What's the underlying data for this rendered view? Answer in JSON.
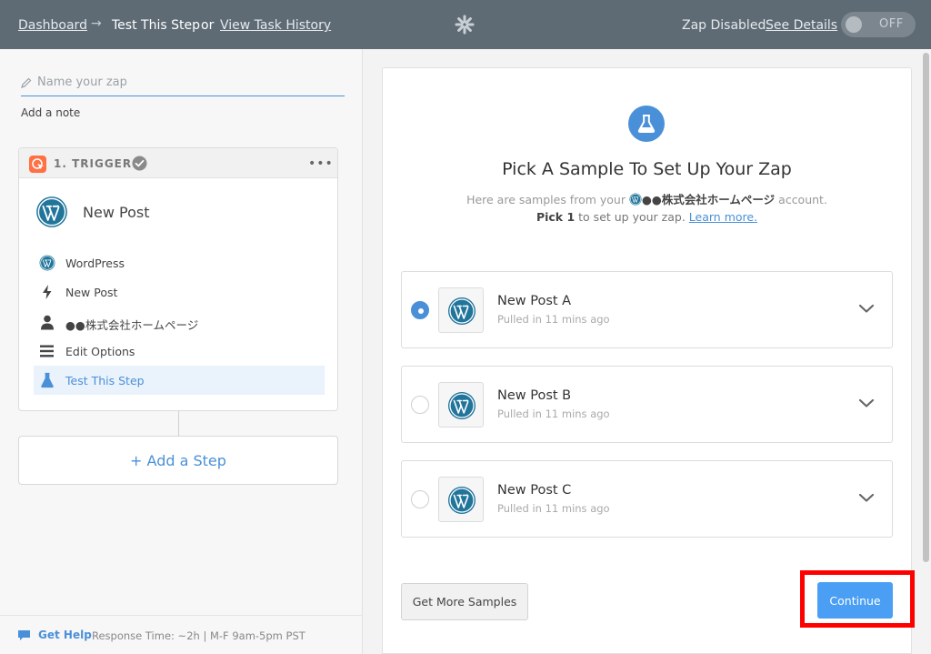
{
  "topbar": {
    "dashboard": "Dashboard",
    "arrow": "→",
    "current": "Test This Step",
    "or": "or",
    "history": "View Task History",
    "status": "Zap Disabled.",
    "details": "See Details",
    "toggle": "OFF"
  },
  "sidebar": {
    "zap_name_placeholder": "Name your zap",
    "add_note": "Add a note",
    "trigger": {
      "label": "1. TRIGGER",
      "menu": "•••",
      "app_title": "New Post",
      "rows": [
        {
          "label": "WordPress",
          "icon": "wordpress-icon"
        },
        {
          "label": "New Post",
          "icon": "bolt-icon"
        },
        {
          "label": "●●株式会社ホームページ",
          "icon": "user-icon"
        },
        {
          "label": "Edit Options",
          "icon": "lines-icon"
        },
        {
          "label": "Test This Step",
          "icon": "flask-icon"
        }
      ]
    },
    "add_step": "Add a Step",
    "add_step_plus": "+",
    "help": {
      "link": "Get Help",
      "text": "Response Time: ~2h | M-F 9am-5pm PST"
    }
  },
  "main": {
    "title": "Pick A Sample To Set Up Your Zap",
    "sub_before": "Here are samples from your",
    "account": "●●株式会社ホームページ",
    "sub_after": "account.",
    "pick": "Pick 1",
    "pick_rest": "to set up your zap.",
    "learn": "Learn more.",
    "samples": [
      {
        "title": "New Post A",
        "sub": "Pulled in 11 mins ago"
      },
      {
        "title": "New Post B",
        "sub": "Pulled in 11 mins ago"
      },
      {
        "title": "New Post C",
        "sub": "Pulled in 11 mins ago"
      }
    ],
    "more_button": "Get More Samples",
    "continue_button": "Continue"
  },
  "colors": {
    "accent": "#4a90d9",
    "topbar": "#5e6b75",
    "highlight": "#ff0000"
  }
}
